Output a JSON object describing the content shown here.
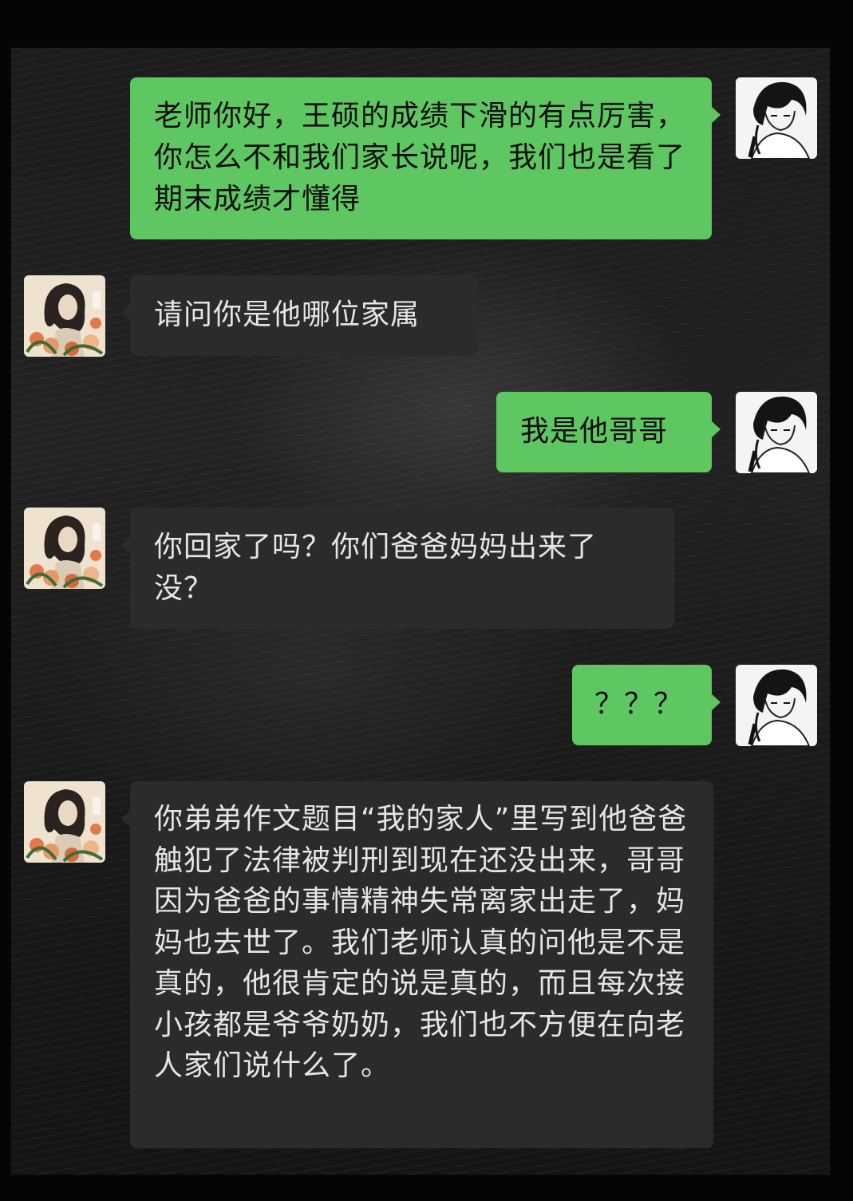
{
  "colors": {
    "sent_bubble": "#5fc761",
    "received_bubble": "#2b2b2b",
    "sent_text": "#0d0d0d",
    "received_text": "#e6e6e6"
  },
  "avatars": {
    "self": "anime-boy-avatar-icon",
    "contact": "woman-with-flowers-avatar-icon"
  },
  "messages": [
    {
      "side": "sent",
      "text": "老师你好，王硕的成绩下滑的有点厉害，你怎么不和我们家长说呢，我们也是看了期末成绩才懂得"
    },
    {
      "side": "received",
      "text": "请问你是他哪位家属"
    },
    {
      "side": "sent",
      "text": "我是他哥哥"
    },
    {
      "side": "received",
      "text": "你回家了吗？你们爸爸妈妈出来了没？"
    },
    {
      "side": "sent",
      "text": "？？？"
    },
    {
      "side": "received",
      "text": "你弟弟作文题目“我的家人”里写到他爸爸触犯了法律被判刑到现在还没出来，哥哥因为爸爸的事情精神失常离家出走了，妈妈也去世了。我们老师认真的问他是不是真的，他很肯定的说是真的，而且每次接小孩都是爷爷奶奶，我们也不方便在向老人家们说什么了。"
    }
  ]
}
